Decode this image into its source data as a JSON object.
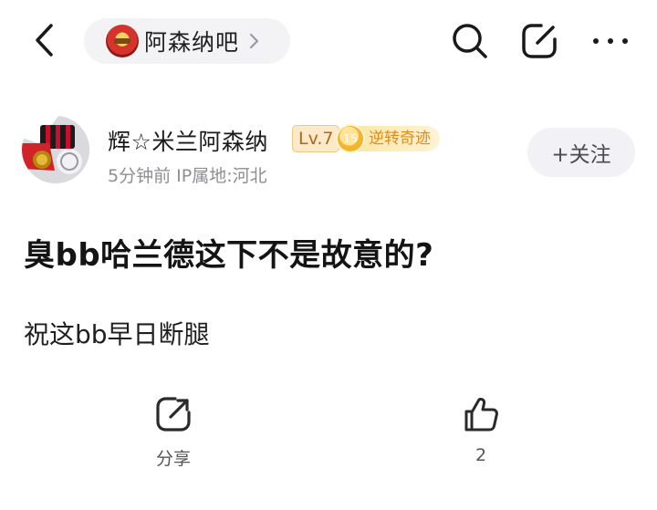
{
  "header": {
    "forum_name": "阿森纳吧"
  },
  "author": {
    "name": "辉☆米兰阿森纳",
    "level": "Lv.7",
    "title_level": "15",
    "title_name": "逆转奇迹",
    "meta": "5分钟前  IP属地:河北"
  },
  "follow_button": {
    "label": "+关注"
  },
  "post": {
    "title": "臭bb哈兰德这下不是故意的?",
    "body": "祝这bb早日断腿"
  },
  "actions": {
    "share_label": "分享",
    "like_count": "2"
  },
  "icons": {
    "back": "chevron-left-icon",
    "forum_chevron": "chevron-right-icon",
    "search": "search-icon",
    "edit": "edit-icon",
    "more": "more-icon",
    "share": "share-icon",
    "like": "thumbs-up-icon"
  },
  "colors": {
    "level_badge_text": "#b0691c",
    "title_badge_text": "#e08a1a",
    "meta_text": "#8e8e93",
    "pill_background": "#f3f3f6"
  }
}
